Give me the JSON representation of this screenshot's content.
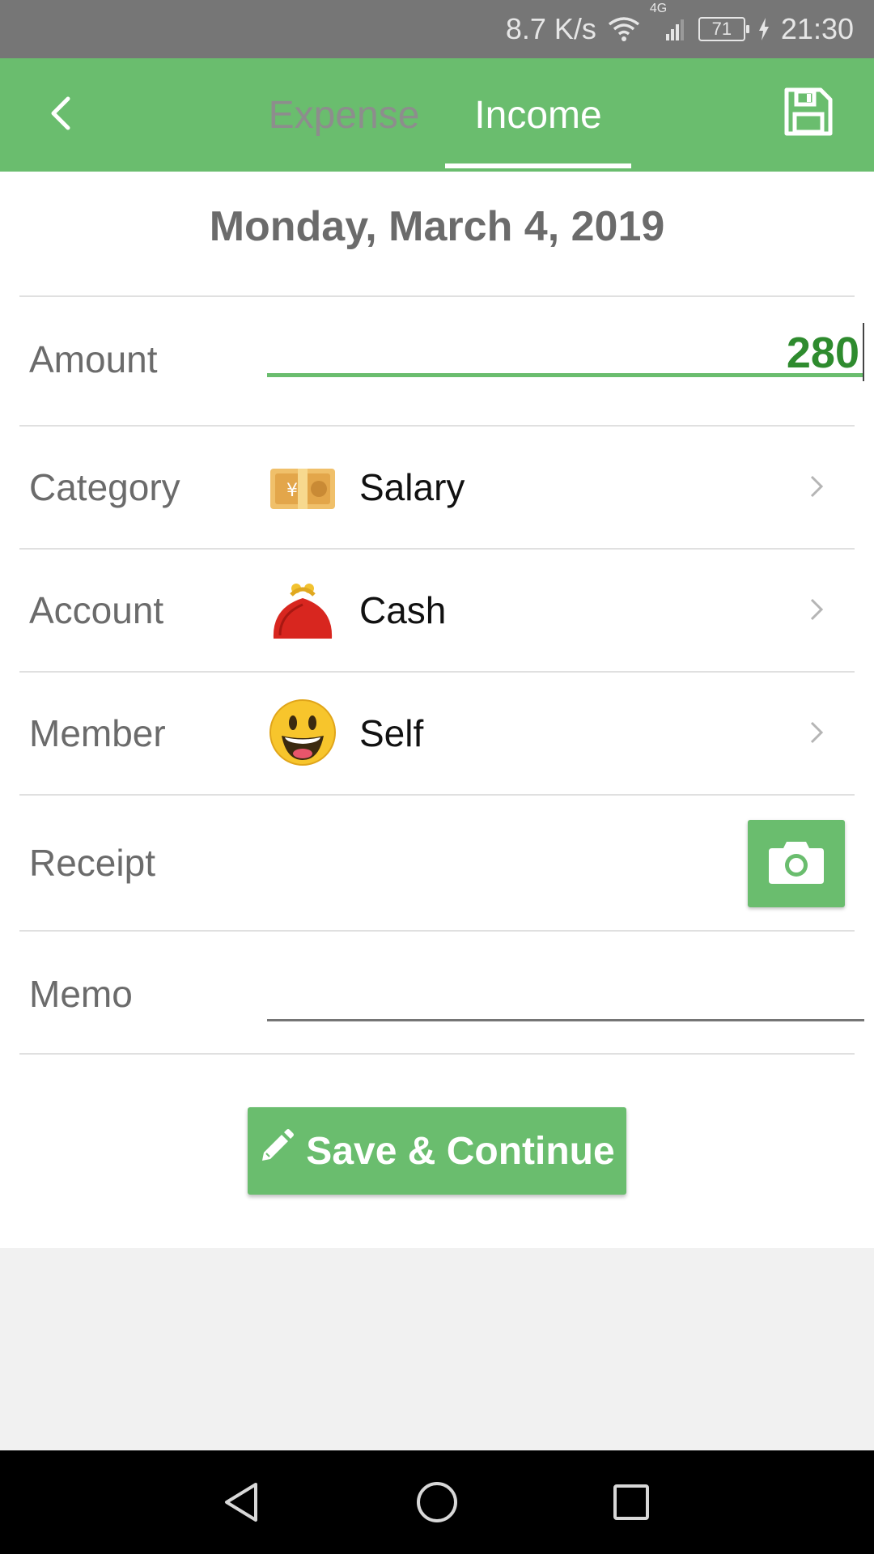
{
  "status_bar": {
    "network_speed": "8.7 K/s",
    "network_type": "4G",
    "battery_level": "71",
    "time": "21:30",
    "icons": [
      "wifi-icon",
      "cellular-signal-icon",
      "battery-icon",
      "charging-icon"
    ]
  },
  "app_bar": {
    "tabs": [
      {
        "label": "Expense",
        "selected": false
      },
      {
        "label": "Income",
        "selected": true
      }
    ],
    "icons": [
      "back-arrow-icon",
      "save-disk-icon"
    ]
  },
  "form": {
    "date": "Monday, March 4, 2019",
    "amount": {
      "label": "Amount",
      "value": "280"
    },
    "category": {
      "label": "Category",
      "value": "Salary",
      "icon": "money-bill-icon"
    },
    "account": {
      "label": "Account",
      "value": "Cash",
      "icon": "coin-purse-icon"
    },
    "member": {
      "label": "Member",
      "value": "Self",
      "icon": "smiley-face-icon"
    },
    "receipt": {
      "label": "Receipt",
      "icon": "camera-icon"
    },
    "memo": {
      "label": "Memo",
      "value": ""
    }
  },
  "actions": {
    "save_continue_label": "Save & Continue",
    "icon": "pencil-icon"
  },
  "colors": {
    "accent": "#6abd6e",
    "amount_text": "#2e8b2e",
    "status_bar": "#767676"
  }
}
